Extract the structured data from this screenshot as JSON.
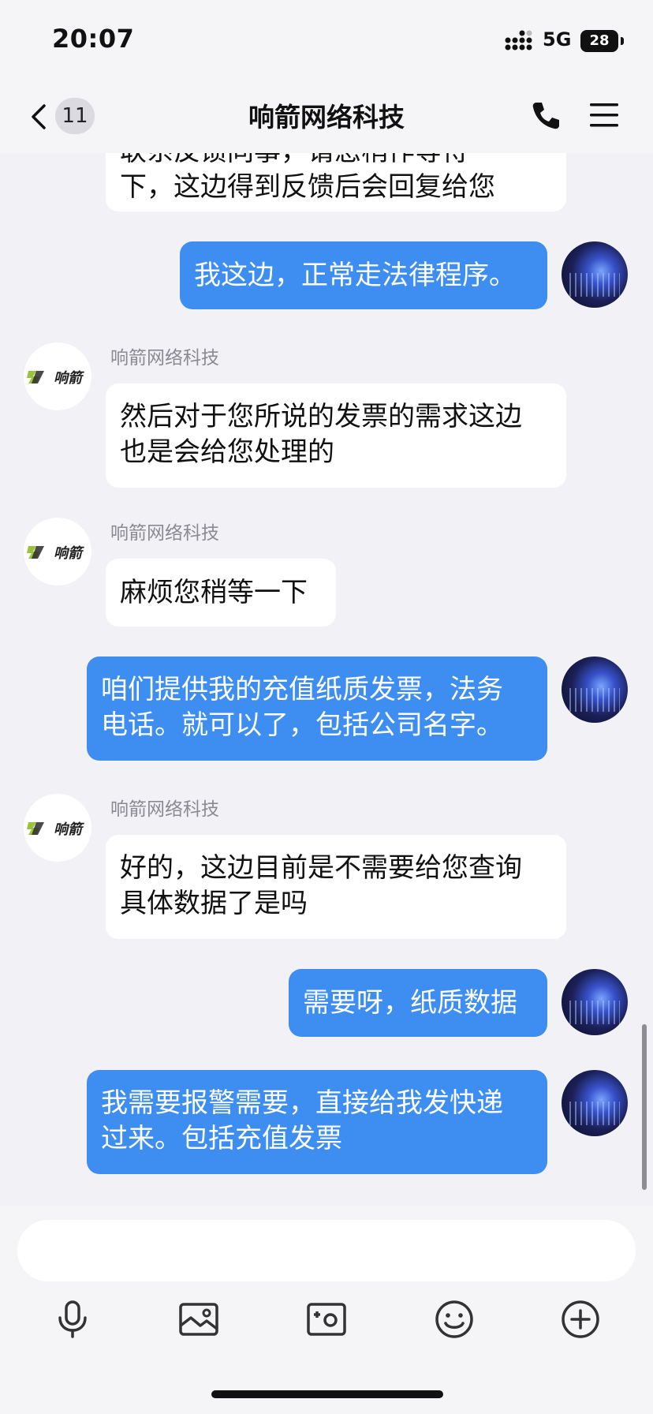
{
  "status_bar": {
    "time": "20:07",
    "network": "5G",
    "battery": "28"
  },
  "nav": {
    "unread_count": "11",
    "title": "响箭网络科技"
  },
  "messages": [
    {
      "dir": "in",
      "text": "下，这边得到反馈后会回复给您",
      "partial_top": "联系反馈同事，请您稍作等待"
    },
    {
      "dir": "out",
      "text": "我这边，正常走法律程序。"
    },
    {
      "dir": "in",
      "sender": "响箭网络科技",
      "line1": "然后对于您所说的发票的需求这边",
      "line2": "也是会给您处理的"
    },
    {
      "dir": "in",
      "sender": "响箭网络科技",
      "text": "麻烦您稍等一下"
    },
    {
      "dir": "out",
      "line1": "咱们提供我的充值纸质发票，法务",
      "line2": "电话。就可以了，包括公司名字。"
    },
    {
      "dir": "in",
      "sender": "响箭网络科技",
      "line1": "好的，这边目前是不需要给您查询",
      "line2": "具体数据了是吗"
    },
    {
      "dir": "out",
      "text": "需要呀，纸质数据"
    },
    {
      "dir": "out",
      "line1": "我需要报警需要，直接给我发快递",
      "line2": "过来。包括充值发票"
    }
  ],
  "brand_logo_text": "响箭",
  "input": {
    "placeholder": ""
  },
  "toolbar": [
    "microphone-icon",
    "image-icon",
    "camera-icon",
    "emoji-icon",
    "plus-icon"
  ],
  "colors": {
    "outgoing_bubble": "#3d8ef0",
    "incoming_bubble": "#ffffff",
    "background": "#f2f2f6"
  }
}
